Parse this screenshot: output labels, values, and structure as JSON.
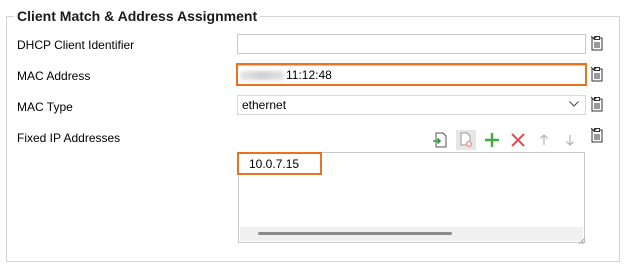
{
  "group": {
    "title": "Client Match & Address Assignment"
  },
  "fields": {
    "dhcp_client_identifier": {
      "label": "DHCP Client Identifier",
      "value": ""
    },
    "mac_address": {
      "label": "MAC Address",
      "value": "11:12:48"
    },
    "mac_type": {
      "label": "MAC Type",
      "value": "ethernet"
    },
    "fixed_ip_addresses": {
      "label": "Fixed IP Addresses",
      "items": [
        "10.0.7.15"
      ]
    }
  },
  "icons": {
    "clipboard": "clipboard-icon",
    "chevron": "chevron-down-icon",
    "import": "import-icon",
    "delete_disabled": "delete-file-icon",
    "add": "plus-icon",
    "remove": "x-icon",
    "up": "arrow-up-icon",
    "down": "arrow-down-icon"
  },
  "colors": {
    "highlight": "#e8731e",
    "add": "#3fae3f",
    "remove": "#e05252",
    "import": "#2f9a3a"
  }
}
